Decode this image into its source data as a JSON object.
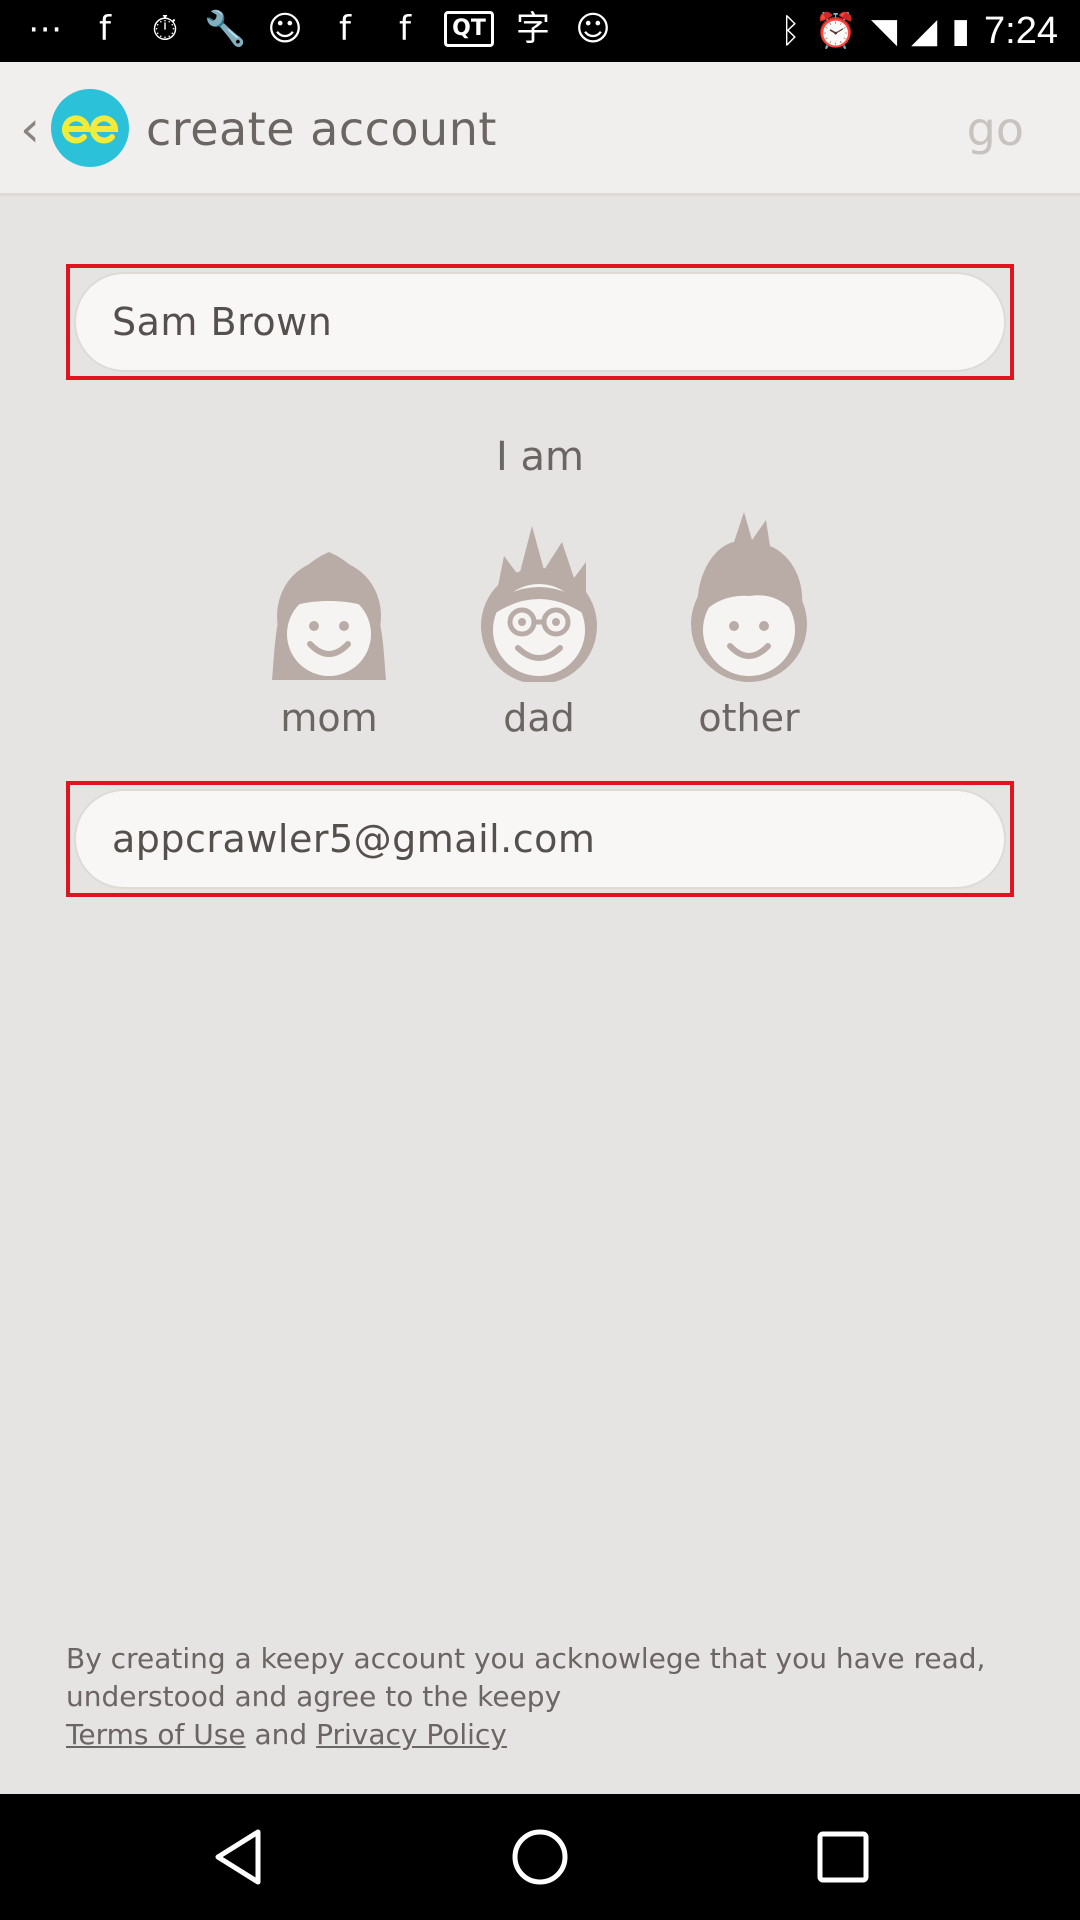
{
  "status_bar": {
    "time": "7:24",
    "icons": [
      "more-dots-icon",
      "facebook-icon",
      "timer-icon",
      "wrench-icon",
      "smiley-icon",
      "facebook-icon",
      "facebook-icon",
      "qt-icon",
      "character-icon",
      "smiley-icon",
      "bluetooth-icon",
      "alarm-icon",
      "wifi-icon",
      "signal-icon",
      "battery-icon"
    ]
  },
  "header": {
    "title": "create account",
    "go_label": "go"
  },
  "form": {
    "name_value": "Sam Brown",
    "i_am_label": "I am",
    "roles": [
      {
        "label": "mom",
        "icon": "mom-avatar-icon"
      },
      {
        "label": "dad",
        "icon": "dad-avatar-icon"
      },
      {
        "label": "other",
        "icon": "other-avatar-icon"
      }
    ],
    "email_value": "appcrawler5@gmail.com"
  },
  "terms": {
    "text": "By creating a keepy account you acknowlege that you have read, understood and agree to the keepy",
    "terms_link": "Terms of Use",
    "and": "and",
    "privacy_link": "Privacy Policy"
  },
  "colors": {
    "accent_logo": "#2bc1d8",
    "highlight_border": "#e0141e",
    "avatar": "#b9aca7"
  }
}
